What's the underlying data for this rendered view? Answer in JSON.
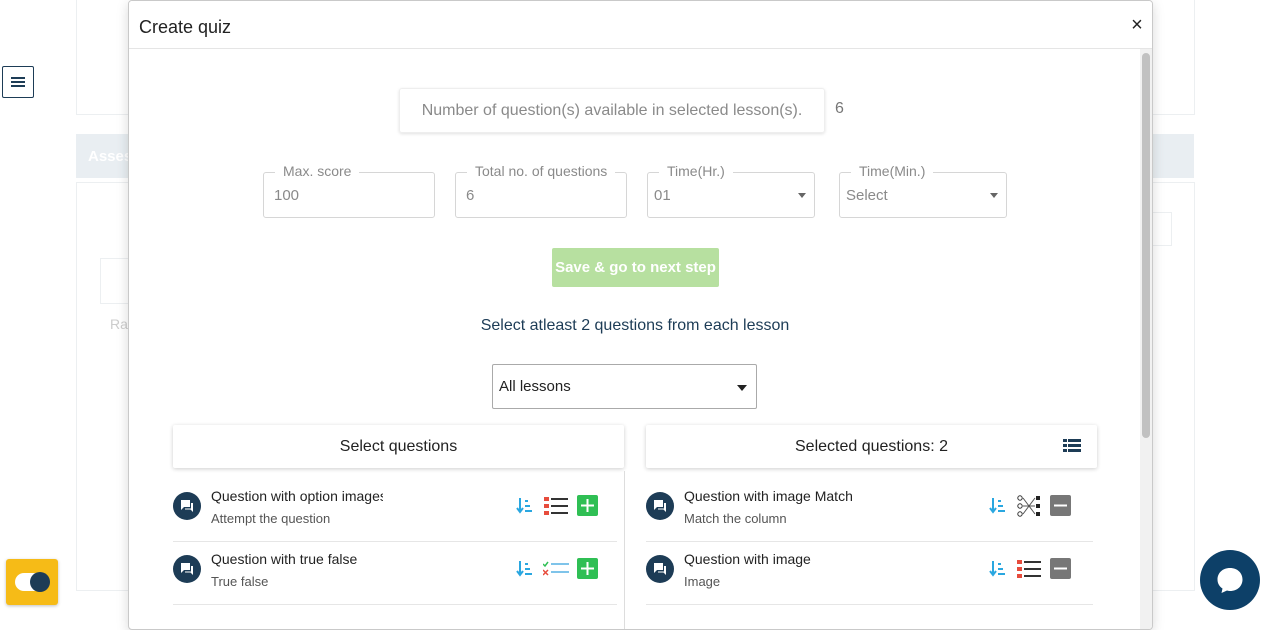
{
  "background": {
    "section_label": "Asses",
    "field_label": "Ra"
  },
  "modal": {
    "title": "Create quiz",
    "close_label": "×"
  },
  "availability": {
    "label": "Number of question(s) available in selected lesson(s).",
    "count": "6"
  },
  "fields": {
    "max_score": {
      "label": "Max. score",
      "value": "100"
    },
    "total_questions": {
      "label": "Total no. of questions",
      "value": "6"
    },
    "time_hr": {
      "label": "Time(Hr.)",
      "value": "01"
    },
    "time_min": {
      "label": "Time(Min.)",
      "value": "Select"
    }
  },
  "save_button": "Save & go to next step",
  "instruction": "Select atleast 2 questions from each lesson",
  "lesson_select": {
    "value": "All lessons"
  },
  "select_panel": {
    "title": "Select questions",
    "items": [
      {
        "title": "Question with option images",
        "subtitle": "Attempt the question"
      },
      {
        "title": "Question with true false",
        "subtitle": "True false"
      }
    ]
  },
  "selected_panel": {
    "title": "Selected questions: 2",
    "items": [
      {
        "title": "Question with image Match",
        "subtitle": "Match the column"
      },
      {
        "title": "Question with image",
        "subtitle": "Image"
      }
    ]
  },
  "colors": {
    "primary": "#1d3c56",
    "sort_icon": "#2aa7e0",
    "add_green": "#2fbf54",
    "remove_gray": "#777777",
    "save_disabled": "#b7e0a0",
    "toggle_yellow": "#f6bb17",
    "chat_blue": "#0d4068"
  }
}
